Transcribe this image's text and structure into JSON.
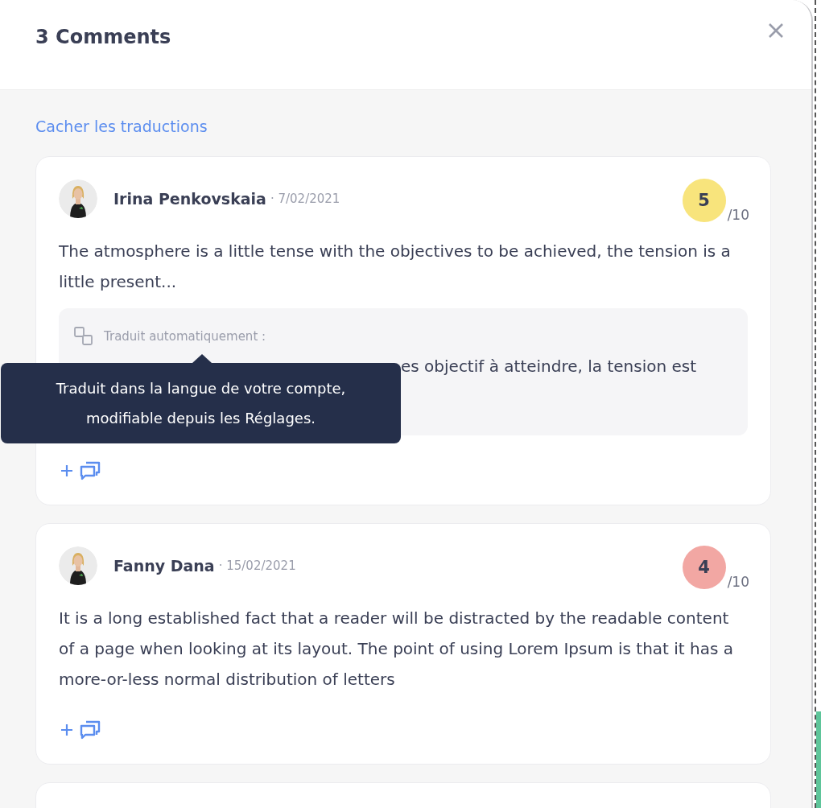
{
  "title": "3 Comments",
  "toggle_link": "Cacher les traductions",
  "comments": [
    {
      "author": "Irina Penkovskaia",
      "date": "· 7/02/2021",
      "score": "5",
      "score_max": "/10",
      "color": "#f8e47c",
      "text": "The atmosphere is a little tense with the objectives to be achieved, the tension is a little present...",
      "translation": {
        "label": "Traduit automatiquement :",
        "text": "es objectif à atteindre, la tension est"
      }
    },
    {
      "author": "Fanny Dana",
      "date": "· 15/02/2021",
      "score": "4",
      "score_max": "/10",
      "color": "#f2a7a3",
      "text": "It is a long established fact that a reader will be distracted by the readable content of a page when looking at its layout. The point of using Lorem Ipsum is that it has a more-or-less normal distribution of letters"
    }
  ],
  "tooltip": "Traduit dans la langue de votre compte, modifiable depuis les Réglages."
}
